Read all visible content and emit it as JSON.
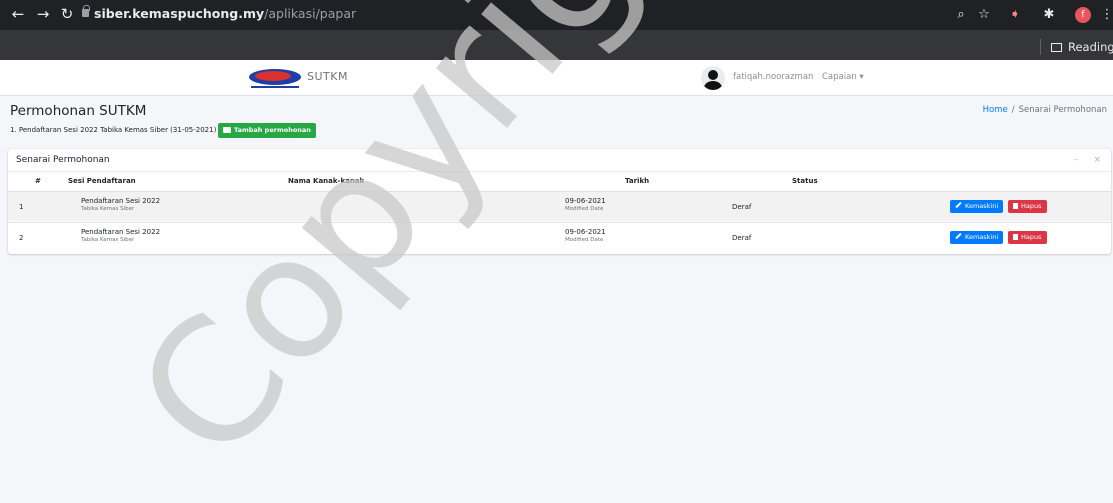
{
  "browser": {
    "url_host": "siber.kemaspuchong.my",
    "url_path": "/aplikasi/papar",
    "reading_list": "Reading list",
    "profile_initial": "f",
    "icons": [
      "back-icon",
      "forward-icon",
      "reload-icon",
      "lock-icon",
      "zoom-icon",
      "star-icon",
      "extension-icon",
      "puzzle-icon",
      "menu-icon"
    ]
  },
  "navbar": {
    "brand": "SUTKM",
    "username": "fatiqah.noorazman",
    "capaian": "Capaian ▾"
  },
  "header": {
    "title": "Permohonan SUTKM",
    "breadcrumb_home": "Home",
    "breadcrumb_sep": "/",
    "breadcrumb_current": "Senarai Permohonan",
    "session_line": "1. Pendaftaran Sesi 2022 Tabika Kemas Siber (31-05-2021)",
    "add_button": "Tambah permohonan"
  },
  "card": {
    "title": "Senarai Permohonan",
    "minimize": "–",
    "close": "×",
    "columns": [
      "#",
      "Sesi Pendaftaran",
      "Nama Kanak-kanak",
      "Tarikh",
      "Status"
    ],
    "rows": [
      {
        "no": "1",
        "sesi": "Pendaftaran Sesi 2022",
        "sesi_sub": "Tabika Kemas Siber",
        "nama": "",
        "tarikh": "09-06-2021",
        "tarikh_sub": "Modified Date",
        "status": "Deraf",
        "edit_label": "Kemaskini",
        "delete_label": "Hapus"
      },
      {
        "no": "2",
        "sesi": "Pendaftaran Sesi 2022",
        "sesi_sub": "Tabika Kemas Siber",
        "nama": "",
        "tarikh": "09-06-2021",
        "tarikh_sub": "Modified Date",
        "status": "Deraf",
        "edit_label": "Kemaskini",
        "delete_label": "Hapus"
      }
    ]
  },
  "watermark": {
    "text": "Copyright@ JKM",
    "color": "#c8c8c8"
  },
  "colors": {
    "primary": "#007bff",
    "danger": "#dc3545",
    "success": "#28a745",
    "chrome_dark": "#35363a"
  }
}
